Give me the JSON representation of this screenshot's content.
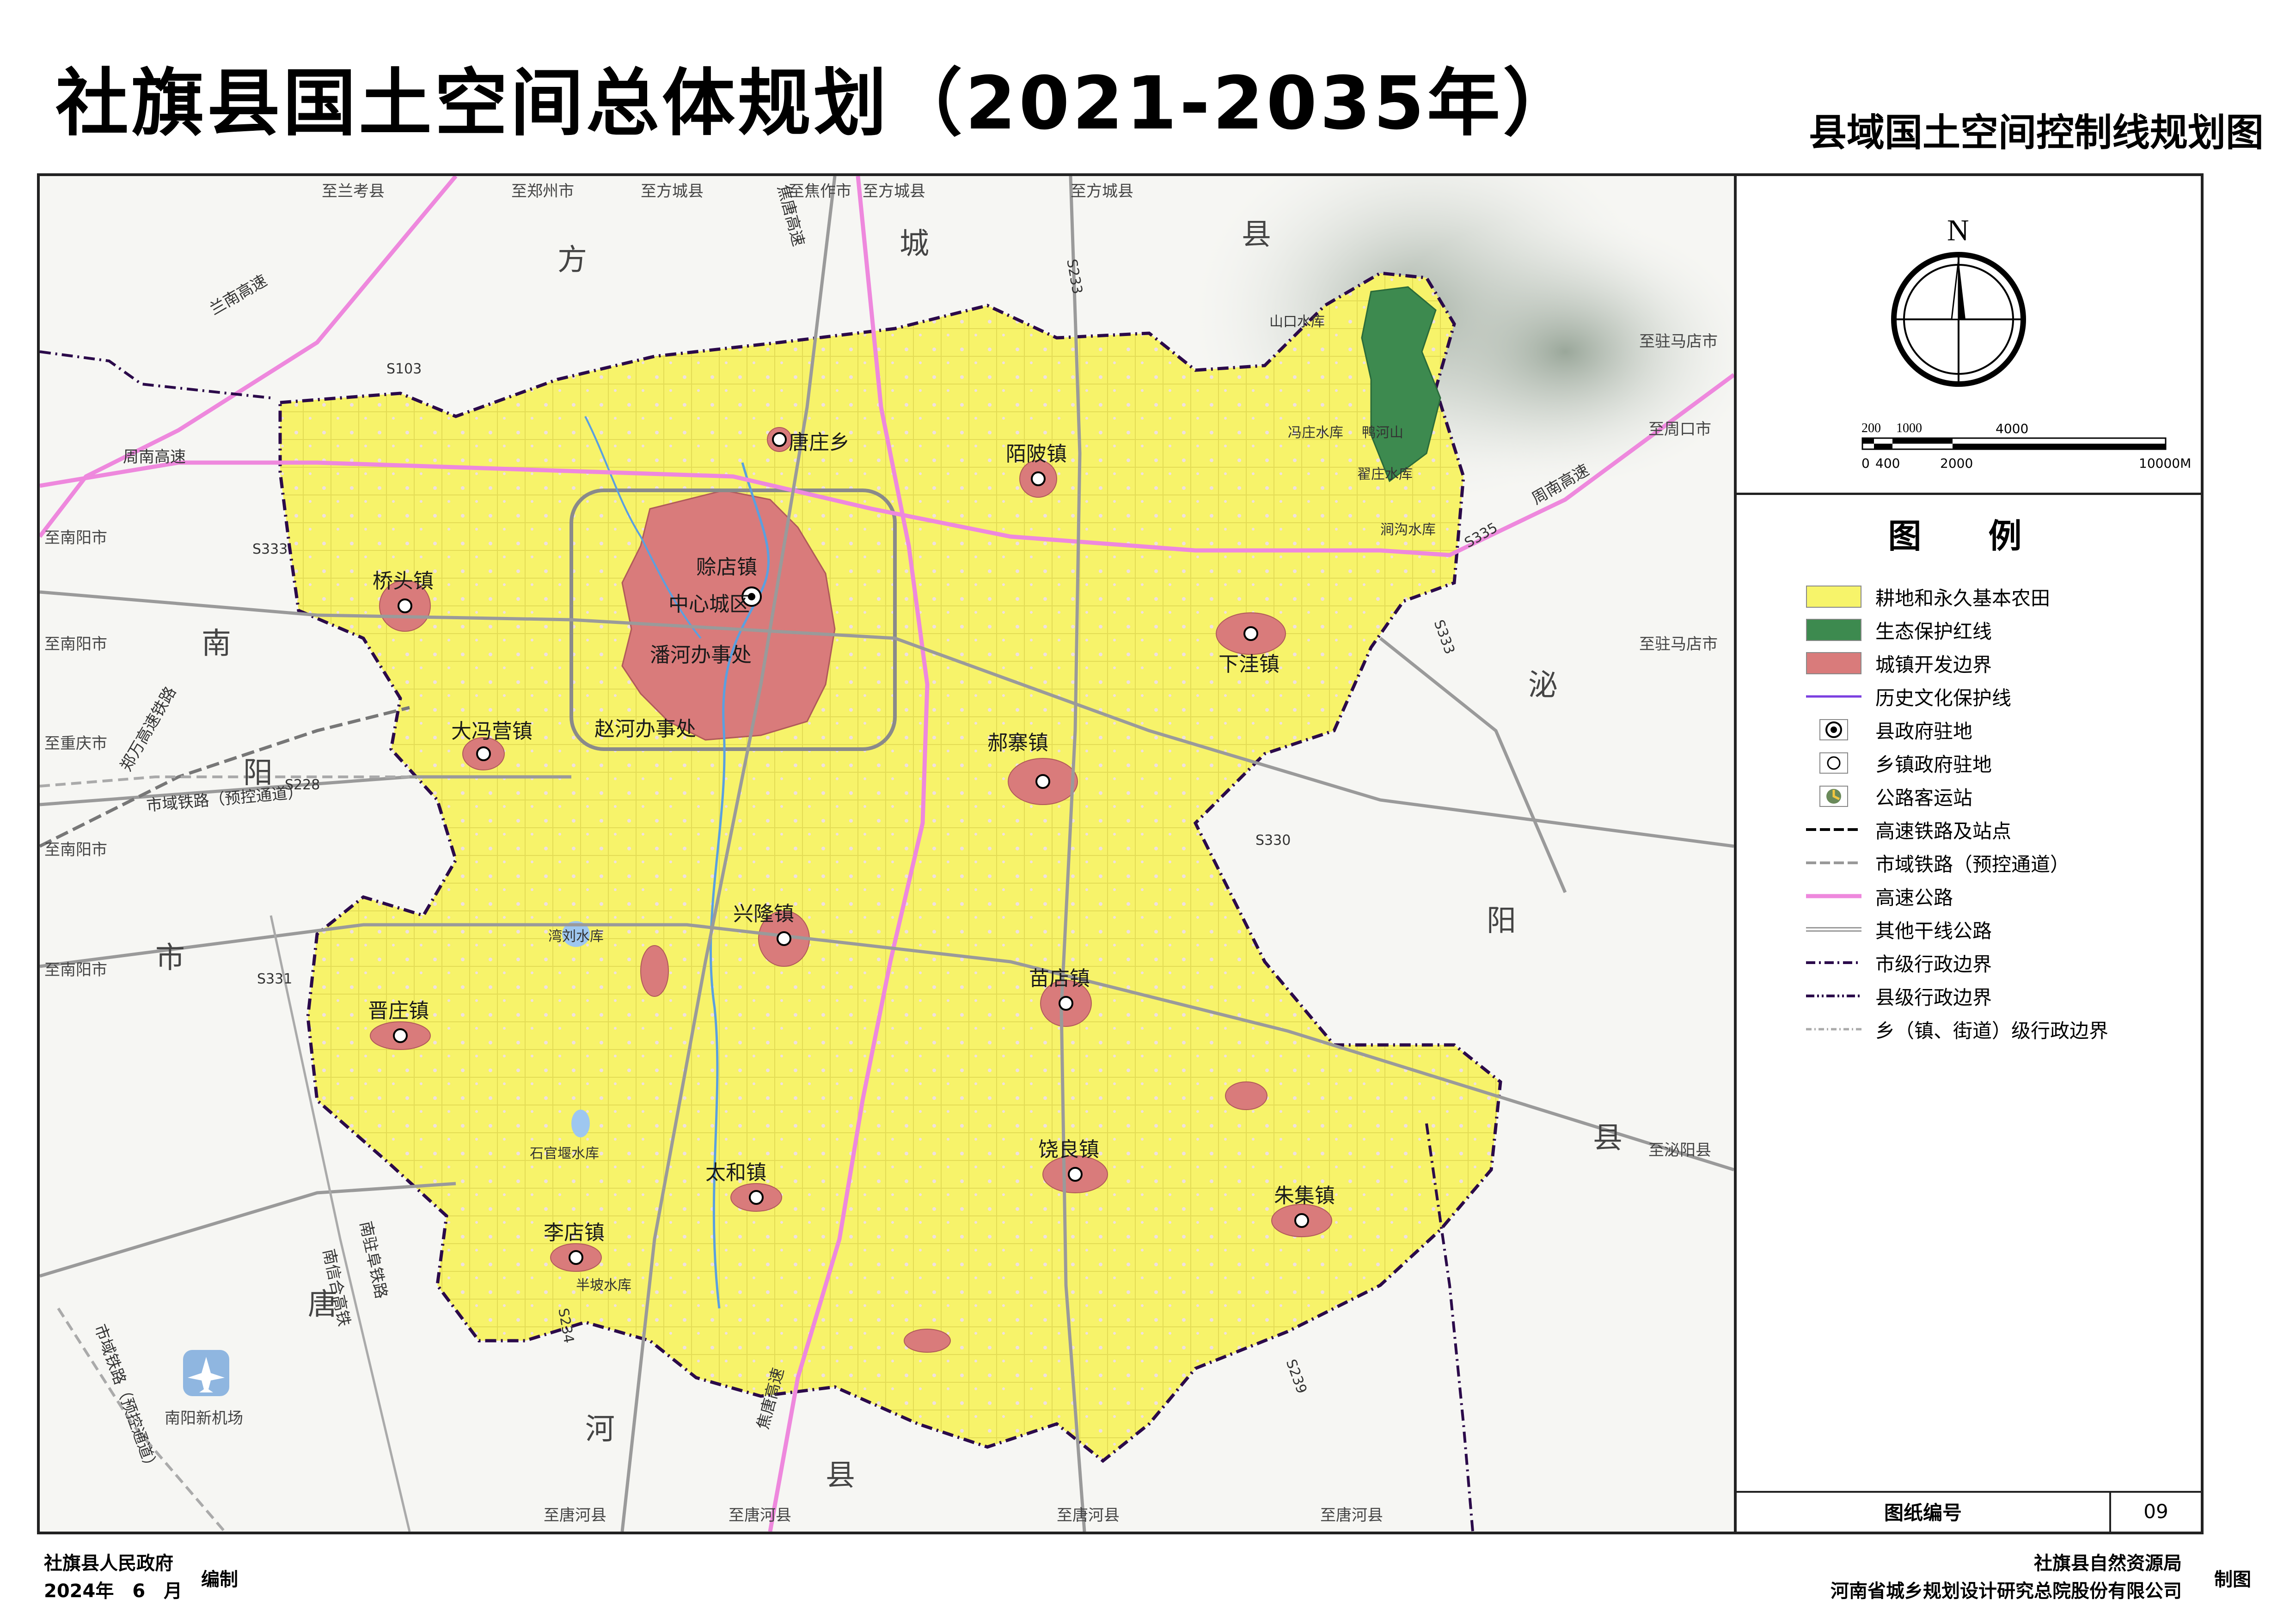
{
  "title": "社旗县国土空间总体规划（2021-2035年）",
  "subtitle": "县域国土空间控制线规划图",
  "north": "N",
  "scale": {
    "top_labels": [
      "200",
      "1000",
      "4000"
    ],
    "bottom_labels": [
      "0",
      "400",
      "2000",
      "10000M"
    ]
  },
  "legend": {
    "title": "图 例",
    "items": [
      {
        "label": "耕地和永久基本农田",
        "color": "#f7f46a",
        "icon": "yellow-fill-swatch"
      },
      {
        "label": "生态保护红线",
        "color": "#3d8a4f",
        "icon": "green-fill-swatch"
      },
      {
        "label": "城镇开发边界",
        "color": "#d97b7b",
        "icon": "pink-fill-swatch"
      },
      {
        "label": "历史文化保护线",
        "color": "#7b3fe0",
        "icon": "purple-line"
      },
      {
        "label": "县政府驻地",
        "color": "#000000",
        "icon": "bullseye-symbol"
      },
      {
        "label": "乡镇政府驻地",
        "color": "#000000",
        "icon": "circle-symbol"
      },
      {
        "label": "公路客运站",
        "color": "#c8a42a",
        "icon": "bus-station-symbol"
      },
      {
        "label": "高速铁路及站点",
        "color": "#000000",
        "icon": "dash-line-black"
      },
      {
        "label": "市域铁路（预控通道）",
        "color": "#999999",
        "icon": "dash-line-gray"
      },
      {
        "label": "高速公路",
        "color": "#ee88dd",
        "icon": "pink-line"
      },
      {
        "label": "其他干线公路",
        "color": "#9a9a9a",
        "icon": "gray-line"
      },
      {
        "label": "市级行政边界",
        "color": "#2b0a4a",
        "icon": "dash-dot-line"
      },
      {
        "label": "县级行政边界",
        "color": "#2b0a4a",
        "icon": "dash-dot-dot-line"
      },
      {
        "label": "乡（镇、街道）级行政边界",
        "color": "#aaaaaa",
        "icon": "dotted-gray-line"
      }
    ]
  },
  "sheet": {
    "label": "图纸编号",
    "number": "09"
  },
  "footer": {
    "left_org": "社旗县人民政府",
    "left_date": "2024年　6　月",
    "left_action": "编制",
    "right_org1": "社旗县自然资源局",
    "right_org2": "河南省城乡规划设计研究总院股份有限公司",
    "right_action": "制图"
  },
  "map": {
    "towns": [
      "赊店镇",
      "中心城区",
      "潘河办事处",
      "赵河办事处",
      "唐庄乡",
      "陌陂镇",
      "桥头镇",
      "下洼镇",
      "大冯营镇",
      "郝寨镇",
      "兴隆镇",
      "苗店镇",
      "晋庄镇",
      "饶良镇",
      "太和镇",
      "朱集镇",
      "李店镇"
    ],
    "regions": [
      "方",
      "城",
      "县",
      "南",
      "阳",
      "市",
      "唐",
      "河",
      "县",
      "泌",
      "阳",
      "县"
    ],
    "destinations": [
      "至兰考县",
      "至郑州市",
      "至方城县",
      "至焦作市",
      "至方城县",
      "至方城县",
      "至驻马店市",
      "至周口市",
      "至驻马店市",
      "至泌阳县",
      "至南阳市",
      "至南阳市",
      "至重庆市",
      "至南阳市",
      "至南阳市",
      "至唐河县",
      "至唐河县",
      "至唐河县",
      "至唐河县"
    ],
    "roads": [
      "兰南高速",
      "周南高速",
      "周南高速",
      "焦唐高速",
      "焦唐高速",
      "郑万高速铁路",
      "南驻阜铁路",
      "南信合高铁",
      "市域铁路（预控通道）",
      "市域铁路（预控通道）",
      "S103",
      "S333",
      "S228",
      "S331",
      "S330",
      "S333",
      "S234",
      "S239",
      "S233",
      "S335"
    ],
    "reservoirs": [
      "山口水库",
      "冯庄水库",
      "鸭河山",
      "翟庄水库",
      "涧沟水库",
      "湾刘水库",
      "石官堰水库",
      "半坡水库"
    ],
    "airport": "南阳新机场"
  }
}
